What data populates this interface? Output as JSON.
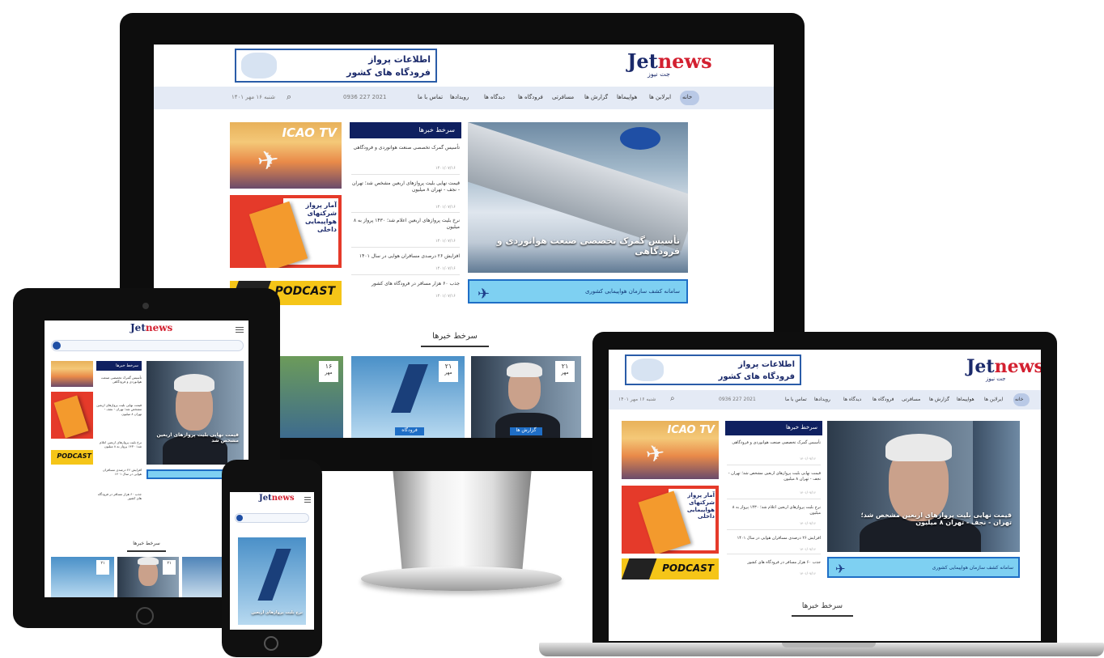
{
  "site": {
    "logo_main": "Jet",
    "logo_accent": "news",
    "logo_sub": "جت نیوز",
    "banner_line1": "اطلاعات پرواز",
    "banner_line2": "فرودگاه های کشور"
  },
  "nav": {
    "home": "خانه",
    "items": [
      "ایرلاین ها",
      "هواپیماها",
      "گزارش ها",
      "مسافرتی",
      "فرودگاه ها",
      "دیدگاه ها",
      "رویدادها",
      "تماس با ما"
    ],
    "phone": "0936 227 2021",
    "date": "شنبه ۱۶ مهر ۱۴۰۱"
  },
  "sidebar": {
    "title": "سرخط خبرها",
    "items": [
      {
        "text": "تأسیس گمرک تخصصی صنعت هوانوردی و فرودگاهی",
        "date": "۱۴۰۱/۰۷/۱۶"
      },
      {
        "text": "قیمت نهایی بلیت پروازهای اربعین مشخص شد؛ تهران - نجف - تهران ۸ میلیون",
        "date": "۱۴۰۱/۰۷/۱۶"
      },
      {
        "text": "نرخ بلیت پروازهای اربعین اعلام شد؛ ۱۴۳۰ پرواز به ۸ میلیون",
        "date": "۱۴۰۱/۰۷/۱۶"
      },
      {
        "text": "افزایش ۲۶ درصدی مسافران هوایی در سال ۱۴۰۱",
        "date": "۱۴۰۱/۰۷/۱۶"
      },
      {
        "text": "جذب ۶۰ هزار مسافر در فرودگاه های کشور",
        "date": "۱۴۰۱/۰۷/۱۶"
      }
    ]
  },
  "hero_monitor": {
    "caption": "تأسیس گمرک تخصصی صنعت هوانوردی و فرودگاهی"
  },
  "hero_laptop": {
    "caption": "قیمت نهایی بلیت پروازهای اربعین مشخص شد؛ تهران - نجف - تهران ۸ میلیون"
  },
  "hero_tablet": {
    "caption": "قیمت نهایی بلیت پروازهای اربعین مشخص شد"
  },
  "hero_phone": {
    "caption": "نرخ بلیت پروازهای اربعین"
  },
  "ads": {
    "icao": "ICAO TV",
    "book_text": "آمار پرواز شرکتهای هواپیمایی داخلی",
    "podcast": "PODCAST",
    "blue_ad": "سامانه کشف سازمان هواپیمایی کشوری"
  },
  "section": {
    "title": "سرخط خبرها"
  },
  "cards": [
    {
      "day": "۱۶",
      "month": "مهر",
      "tag": "فرودگاه"
    },
    {
      "day": "۲۱",
      "month": "مهر",
      "tag": "ایرلاین ها"
    },
    {
      "day": "۲۱",
      "month": "مهر",
      "tag": "گزارش ها"
    }
  ],
  "colors": {
    "brand_navy": "#0f2060",
    "accent_red": "#d32030",
    "nav_bg": "#e4eaf5",
    "ad_blue": "#7ed0f2"
  }
}
